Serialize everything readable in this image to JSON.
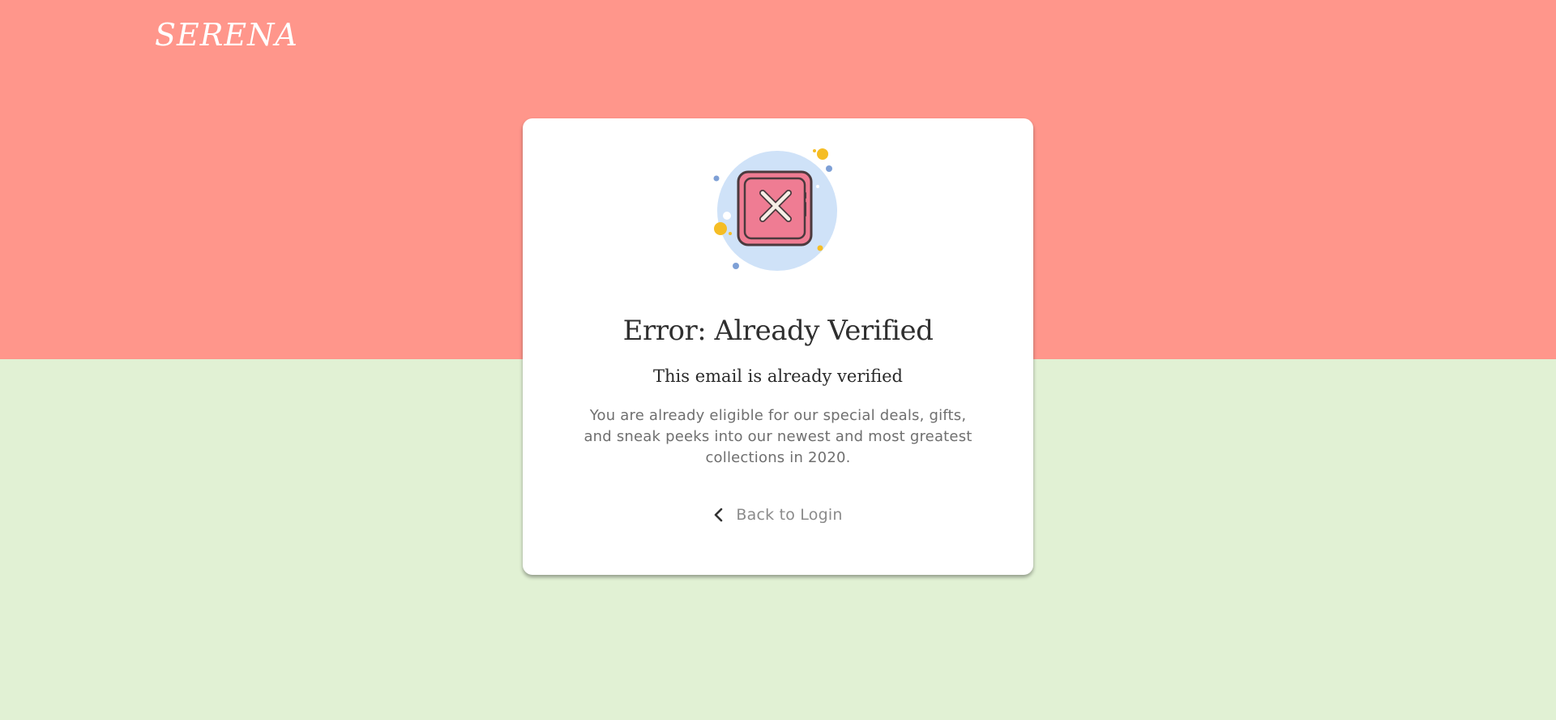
{
  "brand": {
    "name": "SERENA"
  },
  "colors": {
    "top_band": "#ff968b",
    "bottom_band": "#e1f1d4",
    "card_bg": "#ffffff",
    "error_tile": "#ef7c93",
    "error_circle": "#cfe2f8"
  },
  "card": {
    "icon": "error-x-icon",
    "title": "Error: Already Verified",
    "subtitle": "This email is already verified",
    "body": "You are already eligible for our special deals, gifts, and sneak peeks into our newest and most greatest collections in 2020.",
    "back_link": {
      "icon": "chevron-left-icon",
      "label": "Back to Login"
    }
  }
}
